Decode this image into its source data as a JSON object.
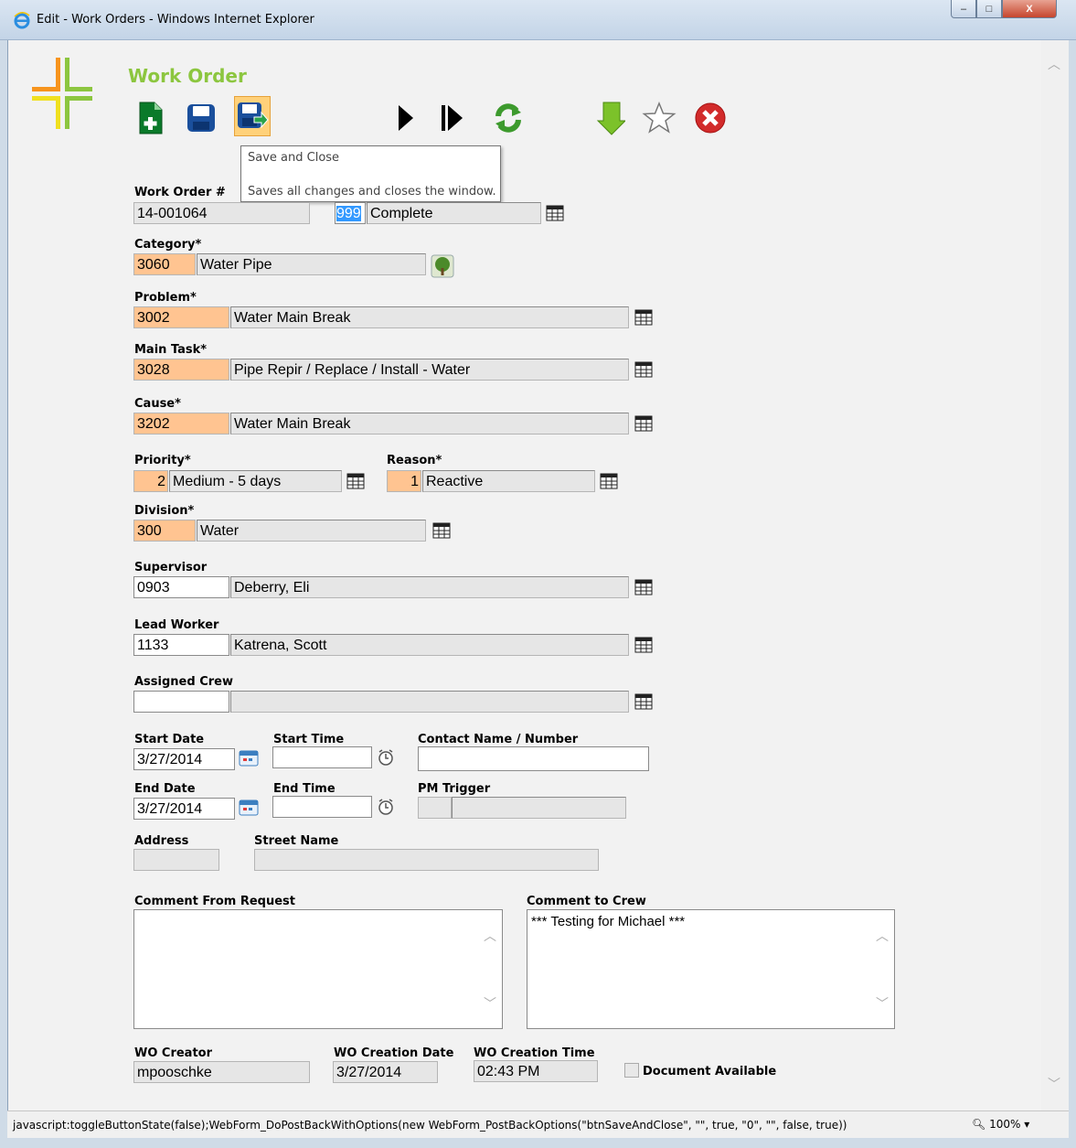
{
  "window": {
    "title": "Edit - Work Orders - Windows Internet Explorer",
    "minimize": "–",
    "maximize": "□",
    "close": "X"
  },
  "page": {
    "title": "Work Order"
  },
  "toolbar": {
    "buttons": [
      {
        "name": "new-record-icon"
      },
      {
        "name": "save-icon"
      },
      {
        "name": "save-and-close-icon"
      },
      {
        "name": "next-icon"
      },
      {
        "name": "last-icon"
      },
      {
        "name": "refresh-icon"
      },
      {
        "name": "download-icon"
      },
      {
        "name": "favorite-star-icon"
      },
      {
        "name": "cancel-icon"
      }
    ]
  },
  "tooltip": {
    "title": "Save and Close",
    "text": "Saves all changes and closes the window."
  },
  "form": {
    "work_order": {
      "label": "Work Order #",
      "value": "14-001064"
    },
    "status": {
      "code": "999",
      "desc": "Complete"
    },
    "category": {
      "label": "Category*",
      "code": "3060",
      "desc": "Water Pipe"
    },
    "problem": {
      "label": "Problem*",
      "code": "3002",
      "desc": "Water Main Break"
    },
    "main_task": {
      "label": "Main Task*",
      "code": "3028",
      "desc": "Pipe Repir / Replace / Install - Water"
    },
    "cause": {
      "label": "Cause*",
      "code": "3202",
      "desc": "Water Main Break"
    },
    "priority": {
      "label": "Priority*",
      "code": "2",
      "desc": "Medium - 5 days"
    },
    "reason": {
      "label": "Reason*",
      "code": "1",
      "desc": "Reactive"
    },
    "division": {
      "label": "Division*",
      "code": "300",
      "desc": "Water"
    },
    "supervisor": {
      "label": "Supervisor",
      "code": "0903",
      "desc": "Deberry, Eli"
    },
    "lead_worker": {
      "label": "Lead Worker",
      "code": "1133",
      "desc": "Katrena, Scott"
    },
    "assigned_crew": {
      "label": "Assigned Crew",
      "code": "",
      "desc": ""
    },
    "start_date": {
      "label": "Start Date",
      "value": "3/27/2014"
    },
    "start_time": {
      "label": "Start Time",
      "value": ""
    },
    "contact": {
      "label": "Contact Name / Number",
      "value": ""
    },
    "end_date": {
      "label": "End Date",
      "value": "3/27/2014"
    },
    "end_time": {
      "label": "End Time",
      "value": ""
    },
    "pm_trigger": {
      "label": "PM Trigger",
      "code": "",
      "desc": ""
    },
    "address": {
      "label": "Address",
      "value": ""
    },
    "street_name": {
      "label": "Street Name",
      "value": ""
    },
    "comment_from_request": {
      "label": "Comment From Request",
      "value": ""
    },
    "comment_to_crew": {
      "label": "Comment to Crew",
      "value": "*** Testing for Michael ***"
    },
    "wo_creator": {
      "label": "WO Creator",
      "value": "mpooschke"
    },
    "wo_creation_date": {
      "label": "WO Creation Date",
      "value": "3/27/2014"
    },
    "wo_creation_time": {
      "label": "WO Creation Time",
      "value": "02:43 PM"
    },
    "document_available": {
      "label": "Document Available",
      "checked": false
    }
  },
  "statusbar": {
    "text": "javascript:toggleButtonState(false);WebForm_DoPostBackWithOptions(new WebForm_PostBackOptions(\"btnSaveAndClose\", \"\", true, \"0\", \"\", false, true))",
    "zoom": "100%"
  },
  "colors": {
    "title_green": "#8cc63f",
    "required_field": "#ffc491",
    "readonly_field": "#e6e6e6",
    "toolbar_active": "#ffd17a"
  }
}
